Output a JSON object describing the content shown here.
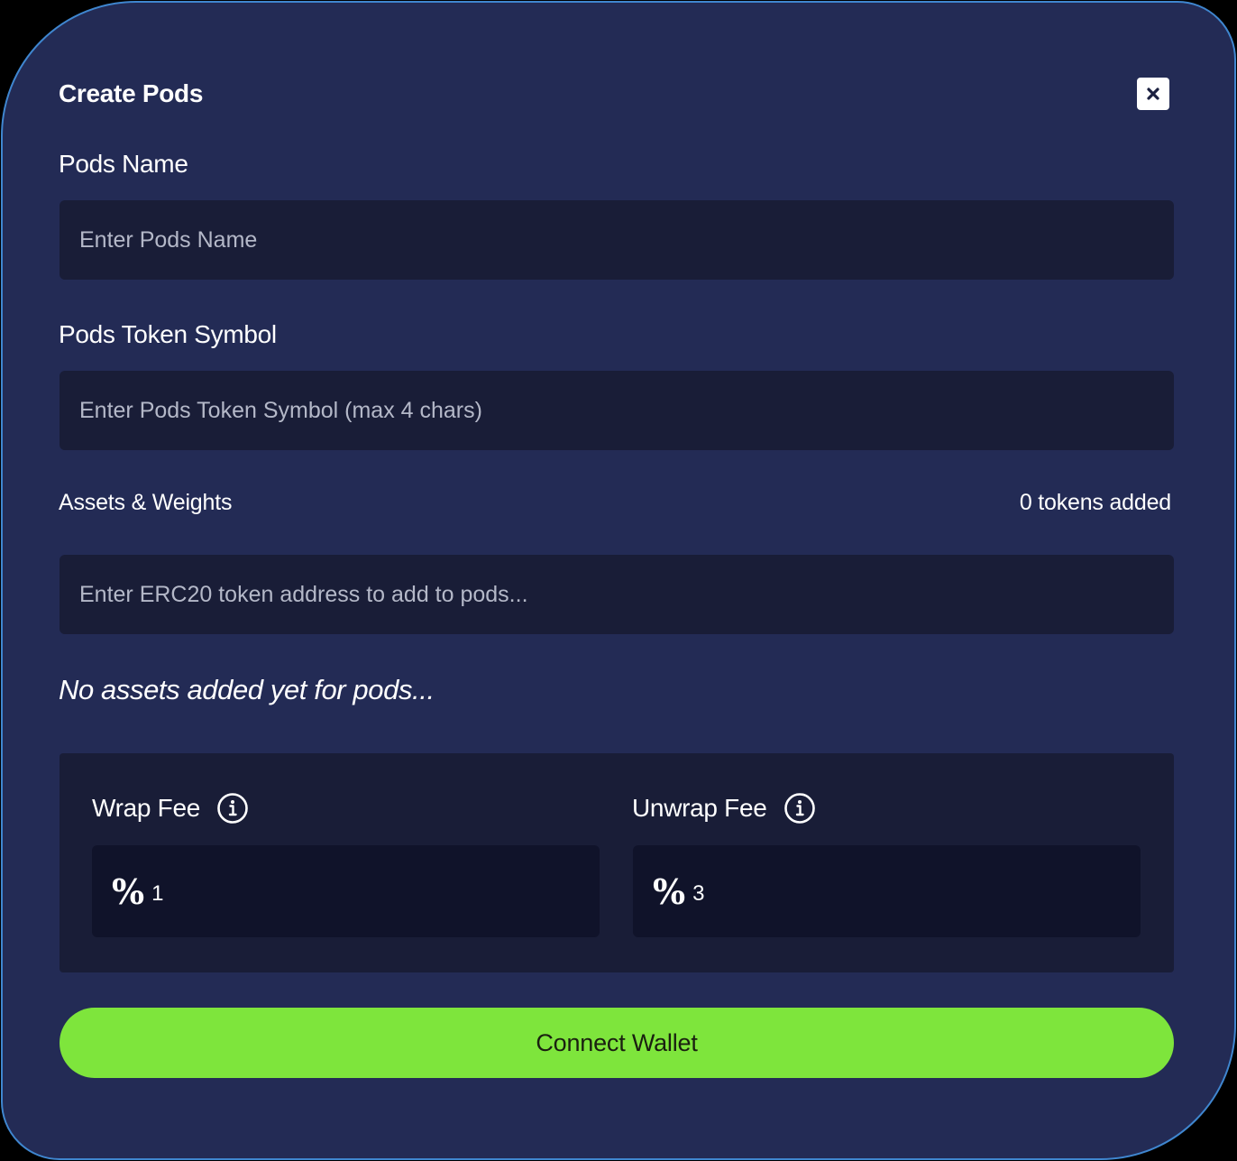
{
  "modal": {
    "title": "Create Pods",
    "close_icon": "close-icon"
  },
  "pods_name": {
    "label": "Pods Name",
    "placeholder": "Enter Pods Name",
    "value": ""
  },
  "token_symbol": {
    "label": "Pods Token Symbol",
    "placeholder": "Enter Pods Token Symbol (max 4 chars)",
    "value": ""
  },
  "assets": {
    "label": "Assets & Weights",
    "count_text": "0 tokens added",
    "placeholder": "Enter ERC20 token address to add to pods...",
    "value": "",
    "empty_message": "No assets added yet for pods..."
  },
  "fees": {
    "wrap": {
      "label": "Wrap Fee",
      "icon": "info-icon",
      "symbol": "%",
      "value": "1"
    },
    "unwrap": {
      "label": "Unwrap Fee",
      "icon": "info-icon",
      "symbol": "%",
      "value": "3"
    }
  },
  "actions": {
    "connect_label": "Connect Wallet"
  },
  "colors": {
    "modal_bg": "#232b55",
    "border": "#3f86cf",
    "input_bg": "#191d37",
    "fee_input_bg": "#10132a",
    "accent": "#7ee53c"
  }
}
